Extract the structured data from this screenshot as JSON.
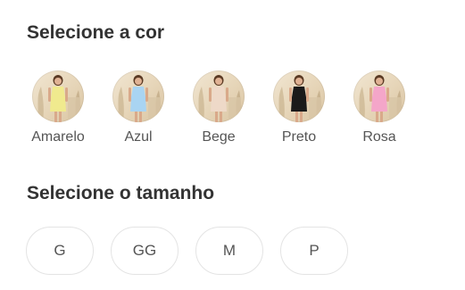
{
  "color_section": {
    "title": "Selecione a cor",
    "options": [
      {
        "label": "Amarelo",
        "dress_color": "#f0ea8e"
      },
      {
        "label": "Azul",
        "dress_color": "#a9d4f2"
      },
      {
        "label": "Bege",
        "dress_color": "#eed9c8"
      },
      {
        "label": "Preto",
        "dress_color": "#1a1a1a"
      },
      {
        "label": "Rosa",
        "dress_color": "#f4a6c9"
      }
    ]
  },
  "size_section": {
    "title": "Selecione o tamanho",
    "options": [
      "G",
      "GG",
      "M",
      "P"
    ]
  }
}
